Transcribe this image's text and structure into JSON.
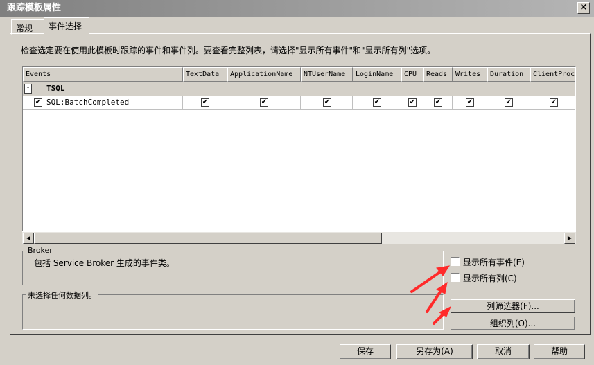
{
  "window": {
    "title": "跟踪模板属性",
    "close_label": "×"
  },
  "tabs": [
    {
      "label": "常规"
    },
    {
      "label": "事件选择"
    }
  ],
  "description": "检查选定要在使用此模板时跟踪的事件和事件列。要查看完整列表，请选择\"显示所有事件\"和\"显示所有列\"选项。",
  "grid": {
    "columns": [
      "Events",
      "TextData",
      "ApplicationName",
      "NTUserName",
      "LoginName",
      "CPU",
      "Reads",
      "Writes",
      "Duration",
      "ClientProc"
    ],
    "group": {
      "toggle": "-",
      "name": "TSQL"
    },
    "rows": [
      {
        "event": "SQL:BatchCompleted",
        "checked": [
          true,
          true,
          true,
          true,
          true,
          true,
          true,
          true,
          true,
          true
        ]
      }
    ],
    "scroll_left": "◀",
    "scroll_right": "▶"
  },
  "broker": {
    "title": "Broker",
    "text": "包括 Service Broker 生成的事件类。"
  },
  "column_info": {
    "text": "未选择任何数据列。"
  },
  "options": {
    "show_all_events": {
      "label": "显示所有事件(E)",
      "checked": false
    },
    "show_all_columns": {
      "label": "显示所有列(C)",
      "checked": false
    }
  },
  "buttons": {
    "column_filters": "列筛选器(F)...",
    "organize_columns": "组织列(O)...",
    "save": "保存",
    "save_as": "另存为(A)",
    "cancel": "取消",
    "help": "帮助"
  },
  "colors": {
    "annotation_arrow": "#ff2a2a",
    "title_bar": "#808080"
  },
  "check_glyph": "✔"
}
